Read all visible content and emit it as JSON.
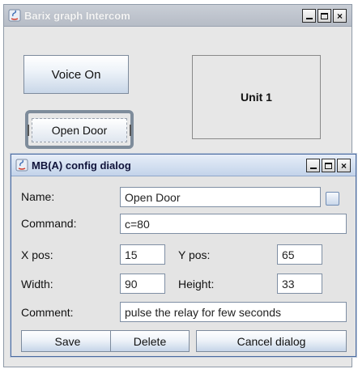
{
  "main_window": {
    "title": "Barix graph Intercom",
    "voice_button_label": "Voice On",
    "unit_label": "Unit 1",
    "open_door_label": "Open Door"
  },
  "dialog": {
    "title": "MB(A) config dialog",
    "labels": {
      "name": "Name:",
      "command": "Command:",
      "xpos": "X pos:",
      "ypos": "Y pos:",
      "width": "Width:",
      "height": "Height:",
      "comment": "Comment:"
    },
    "values": {
      "name": "Open Door",
      "command": "c=80",
      "xpos": "15",
      "ypos": "65",
      "width": "90",
      "height": "33",
      "comment": "pulse the relay for few seconds"
    },
    "buttons": {
      "save": "Save",
      "delete": "Delete",
      "cancel": "Cancel dialog"
    }
  },
  "window_controls": {
    "close_glyph": "×"
  }
}
